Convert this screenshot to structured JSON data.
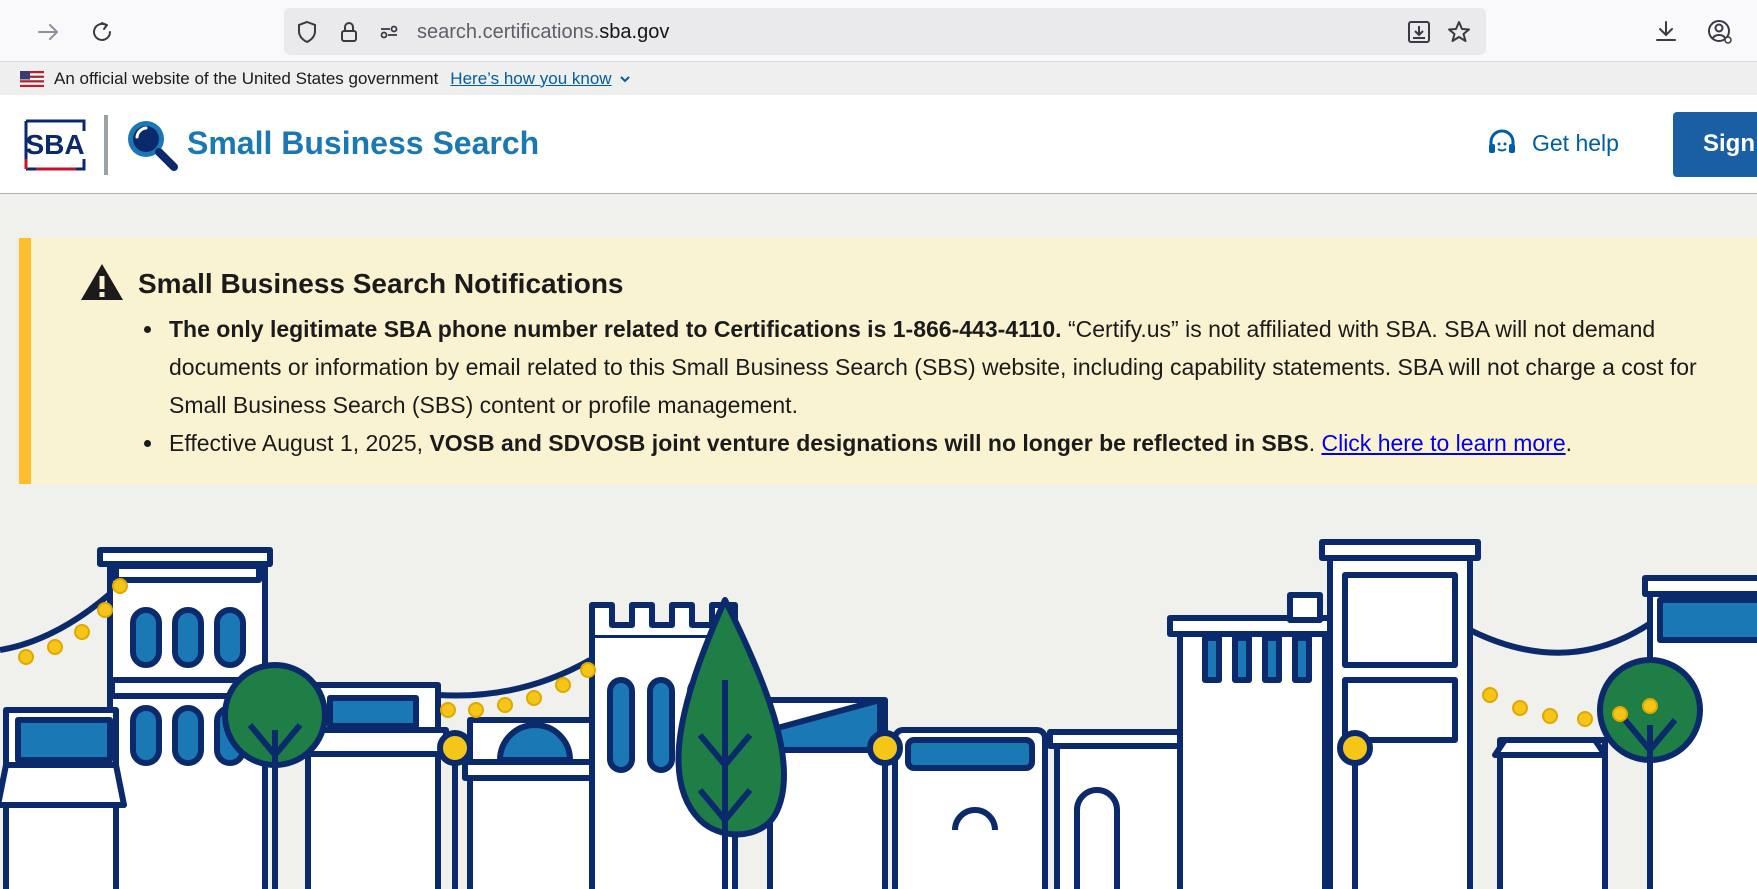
{
  "browser": {
    "url_prefix": "search.certifications.",
    "url_domain": "sba.gov"
  },
  "gov_banner": {
    "official_text": "An official website of the United States government",
    "how_you_know": "Here’s how you know"
  },
  "header": {
    "logo_text": "SBA",
    "site_title": "Small Business Search",
    "get_help": "Get help",
    "sign_in": "Sign i"
  },
  "notice": {
    "title": "Small Business Search Notifications",
    "item1_bold": "The only legitimate SBA phone number related to Certifications is 1-866-443-4110.",
    "item1_rest": " “Certify.us” is not affiliated with SBA. SBA will not demand documents or information by email related to this Small Business Search (SBS) website, including capability statements. SBA will not charge a cost for Small Business Search (SBS) content or profile management.",
    "item2_prefix": "Effective August 1, 2025, ",
    "item2_bold": "VOSB and SDVOSB joint venture designations will no longer be reflected in SBS",
    "item2_sep": ". ",
    "item2_link": "Click here to learn more",
    "item2_end": "."
  },
  "colors": {
    "brand_blue": "#1a78b4",
    "sign_in_bg": "#1a5fa3",
    "notice_bg": "#faf3d1",
    "notice_accent": "#ffbe2e",
    "navy": "#0b2a6b",
    "tree_green": "#1e7e45",
    "lamp_yellow": "#f5c518"
  },
  "icons": [
    "back-arrow-icon",
    "reload-icon",
    "shield-icon",
    "lock-icon",
    "site-settings-icon",
    "install-icon",
    "star-icon",
    "download-icon",
    "account-icon",
    "chevron-down-icon",
    "magnifier-icon",
    "headset-icon",
    "warning-icon"
  ]
}
